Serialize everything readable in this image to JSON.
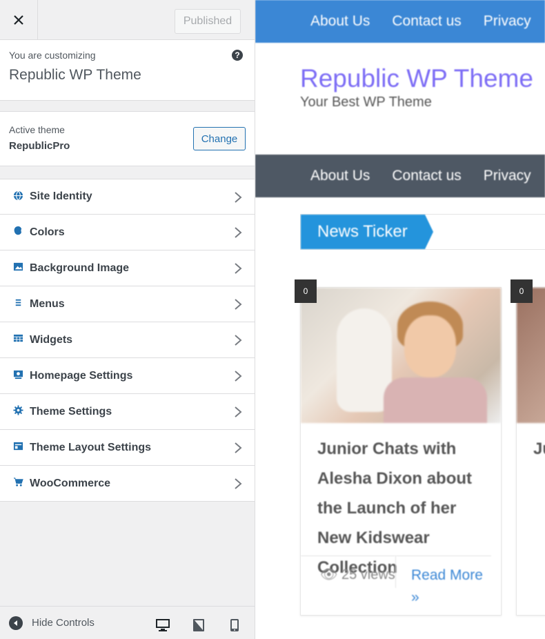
{
  "topbar": {
    "published_label": "Published"
  },
  "info": {
    "customizing_label": "You are customizing",
    "site_name": "Republic WP Theme"
  },
  "theme": {
    "active_label": "Active theme",
    "name": "RepublicPro",
    "change_label": "Change"
  },
  "menu": [
    {
      "label": "Site Identity",
      "icon": "globe-icon"
    },
    {
      "label": "Colors",
      "icon": "palette-icon"
    },
    {
      "label": "Background Image",
      "icon": "image-icon"
    },
    {
      "label": "Menus",
      "icon": "menu-icon"
    },
    {
      "label": "Widgets",
      "icon": "widgets-icon"
    },
    {
      "label": "Homepage Settings",
      "icon": "homepage-icon"
    },
    {
      "label": "Theme Settings",
      "icon": "gear-icon"
    },
    {
      "label": "Theme Layout Settings",
      "icon": "layout-icon"
    },
    {
      "label": "WooCommerce",
      "icon": "cart-icon"
    }
  ],
  "footer": {
    "hide_controls_label": "Hide Controls"
  },
  "preview": {
    "nav": [
      "About Us",
      "Contact us",
      "Privacy"
    ],
    "site_title": "Republic WP Theme",
    "tagline": "Your Best WP Theme",
    "ticker_label": "News Ticker",
    "cards": [
      {
        "badge": "0",
        "title": "Junior Chats with Alesha Dixon about the Launch of her New Kidswear Collection",
        "views": "25 views",
        "read_more": "Read More »"
      },
      {
        "badge": "0",
        "title": "Ju th C"
      }
    ]
  },
  "colors": {
    "accent": "#2271b1",
    "preview_nav": "#3b87d5",
    "title": "#7c6cf5",
    "ticker": "#2494dc"
  }
}
